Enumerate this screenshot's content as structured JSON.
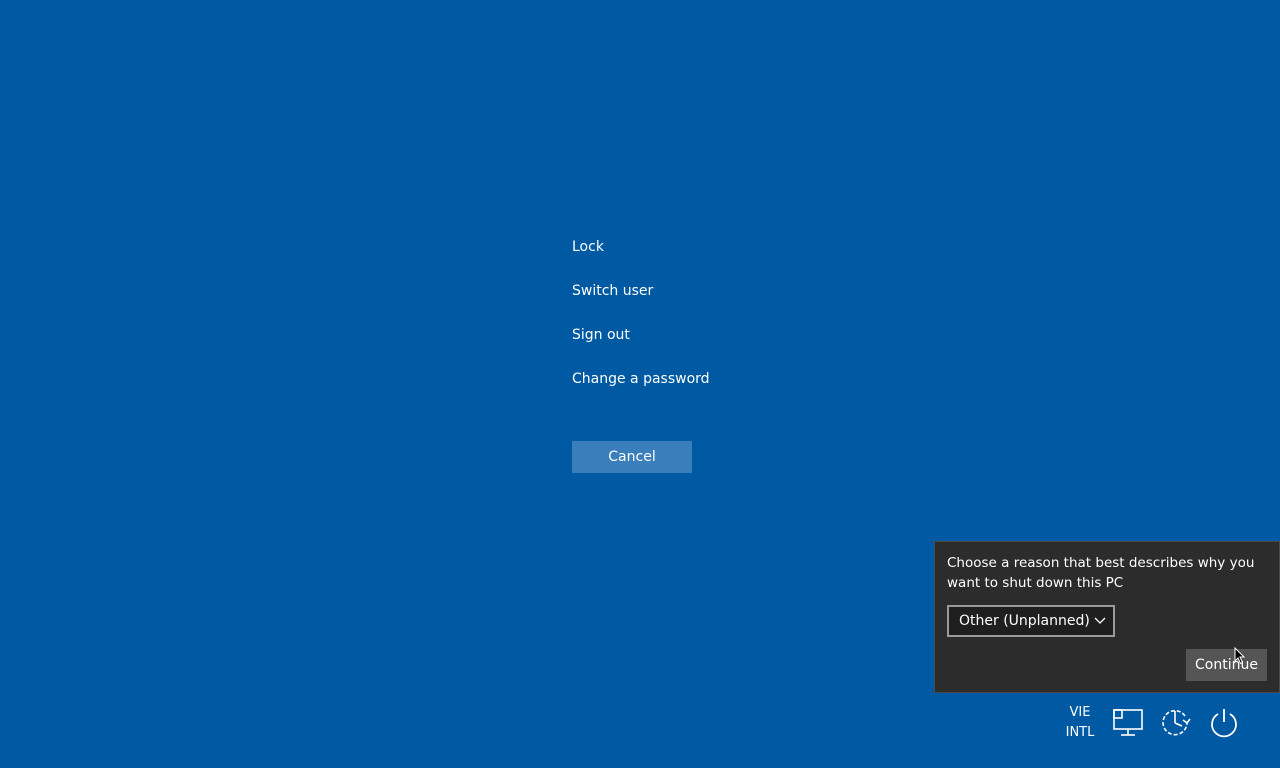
{
  "menu": {
    "items": [
      {
        "label": "Lock"
      },
      {
        "label": "Switch user"
      },
      {
        "label": "Sign out"
      },
      {
        "label": "Change a password"
      }
    ],
    "cancel_label": "Cancel"
  },
  "shutdown_reason": {
    "prompt": "Choose a reason that best describes why you want to shut down this PC",
    "selected_reason": "Other (Unplanned)",
    "continue_label": "Continue"
  },
  "tray": {
    "language_line1": "VIE",
    "language_line2": "INTL",
    "icons": [
      "network-icon",
      "accessibility-icon",
      "power-icon"
    ]
  },
  "colors": {
    "background": "#005aa3",
    "panel": "#2c2c2c",
    "cancel_button": "#3a7ebb",
    "continue_button": "#555555"
  }
}
